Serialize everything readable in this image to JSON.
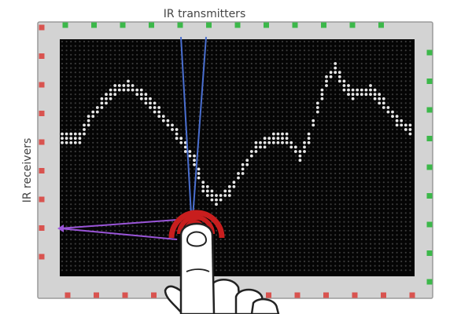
{
  "labels": {
    "transmitters": "IR transmitters",
    "receivers": "IR receivers"
  },
  "colors": {
    "frame": "#d3d3d3",
    "frame_border": "#9a9a9a",
    "screen": "#050505",
    "pixel_off": "#3a3a3a",
    "pixel_on": "#e8e8e8",
    "transmitter_led": "#3cb84a",
    "receiver_led": "#d9534f",
    "transmitter_beam": "#4a6fd0",
    "receiver_beam": "#9a55d8",
    "touch_ring": "#c81e1e",
    "finger_fill": "#ffffff",
    "finger_outline": "#222222"
  },
  "icons": {
    "touch": "finger-touch-icon",
    "ripple": "touch-ripple-icon"
  }
}
